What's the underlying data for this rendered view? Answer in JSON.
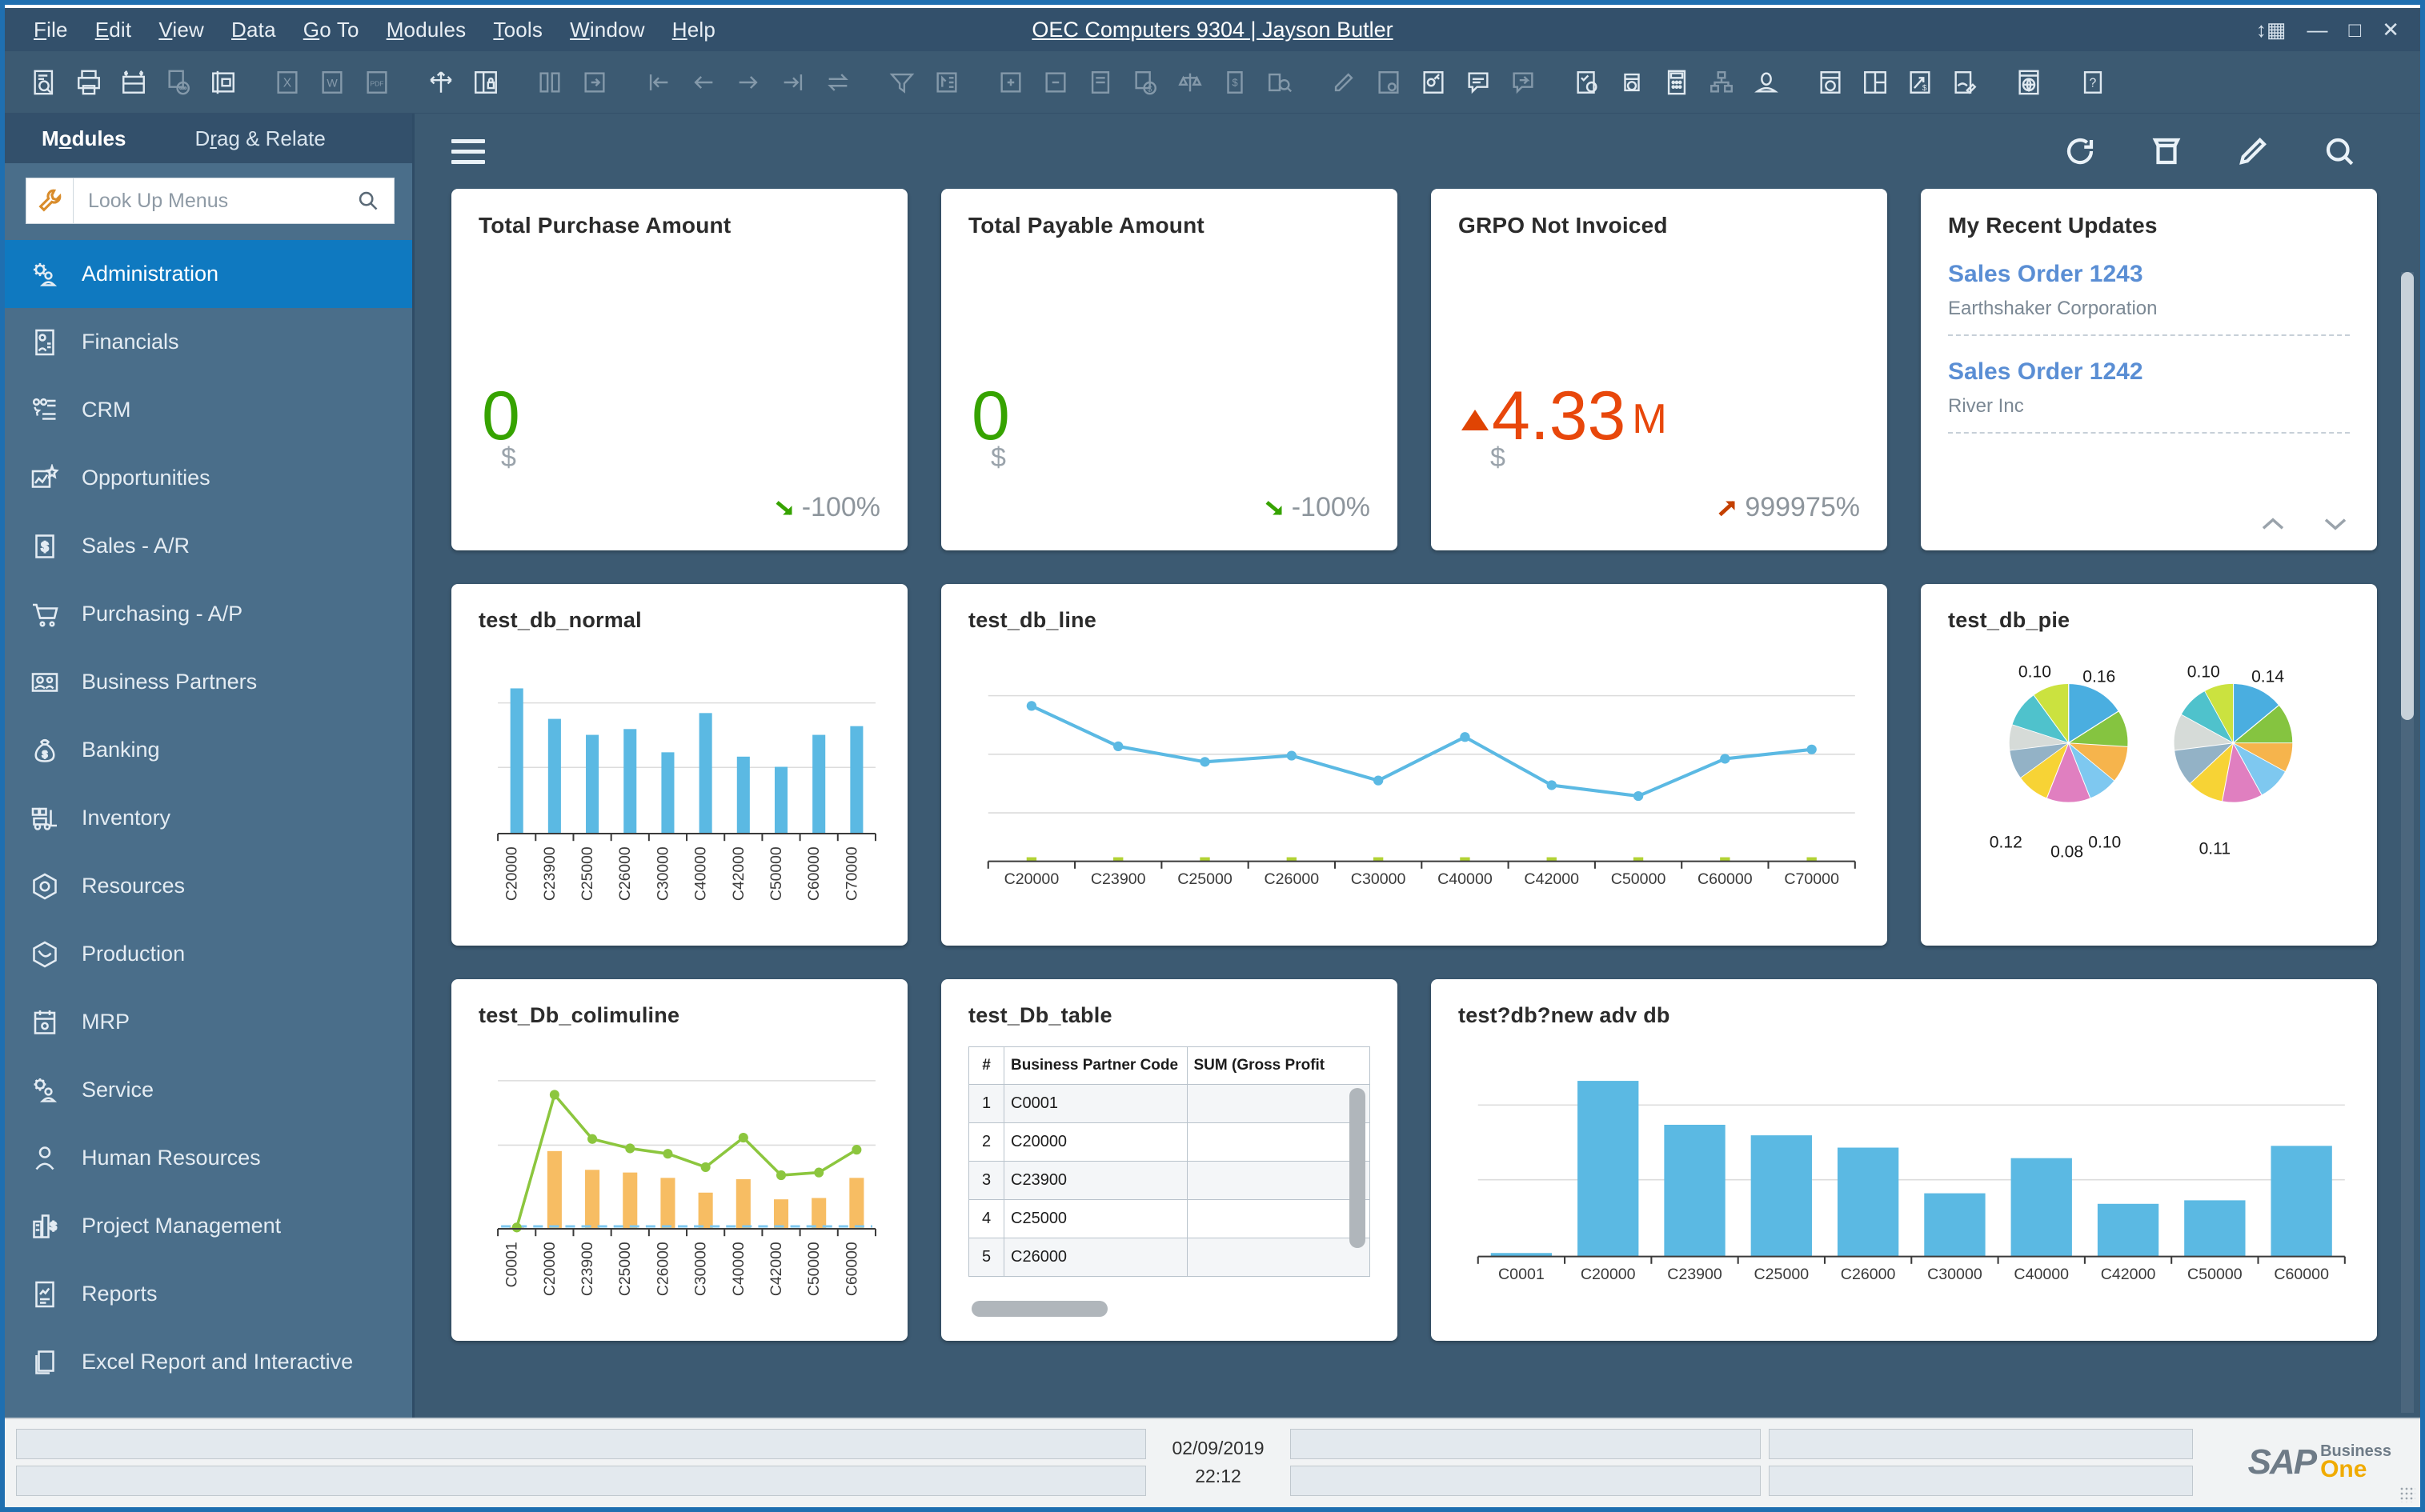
{
  "window": {
    "title": "OEC Computers 9304 | Jayson Butler",
    "controls": [
      "resize-icon",
      "minimize-icon",
      "maximize-icon",
      "close-icon"
    ]
  },
  "menubar": [
    {
      "label": "File",
      "mnemonic": "F"
    },
    {
      "label": "Edit",
      "mnemonic": "E"
    },
    {
      "label": "View",
      "mnemonic": "V"
    },
    {
      "label": "Data",
      "mnemonic": "D"
    },
    {
      "label": "Go To",
      "mnemonic": "G"
    },
    {
      "label": "Modules",
      "mnemonic": "M"
    },
    {
      "label": "Tools",
      "mnemonic": "T"
    },
    {
      "label": "Window",
      "mnemonic": "W"
    },
    {
      "label": "Help",
      "mnemonic": "H"
    }
  ],
  "toolbar": {
    "icons": [
      "find-document-icon",
      "print-icon",
      "print-preview-icon",
      "print-comment-icon",
      "layout-designer-icon",
      "export-excel-icon",
      "export-word-icon",
      "export-pdf-icon",
      "move-icon",
      "lock-screen-icon",
      "link-modules-icon",
      "goto-icon",
      "first-record-icon",
      "previous-record-icon",
      "next-record-icon",
      "last-record-icon",
      "swap-icon",
      "filter-icon",
      "sort-icon",
      "add-row-icon",
      "remove-row-icon",
      "document-journal-icon",
      "payment-icon",
      "balance-icon",
      "bank-icon",
      "query-icon",
      "edit-icon",
      "settings-doc-icon",
      "form-settings-icon",
      "message-icon",
      "reply-message-icon",
      "approval-icon",
      "alert-icon",
      "calculator-icon",
      "org-chart-icon",
      "user-icon",
      "document-globe-icon",
      "layout-tiles-icon",
      "trend-cost-icon",
      "signature-icon",
      "web-icon",
      "help-icon"
    ]
  },
  "sidebar": {
    "tabs": [
      {
        "label": "Modules",
        "mnemonic": "o",
        "active": true
      },
      {
        "label": "Drag & Relate",
        "mnemonic": "r",
        "active": false
      }
    ],
    "search": {
      "placeholder": "Look Up Menus",
      "value": "",
      "icon": "wrench-icon",
      "search_icon": "search-icon"
    },
    "items": [
      {
        "label": "Administration",
        "icon": "administration-icon",
        "active": true
      },
      {
        "label": "Financials",
        "icon": "financials-icon",
        "active": false
      },
      {
        "label": "CRM",
        "icon": "crm-icon",
        "active": false
      },
      {
        "label": "Opportunities",
        "icon": "opportunities-icon",
        "active": false
      },
      {
        "label": "Sales - A/R",
        "icon": "sales-icon",
        "active": false
      },
      {
        "label": "Purchasing - A/P",
        "icon": "cart-icon",
        "active": false
      },
      {
        "label": "Business Partners",
        "icon": "partners-icon",
        "active": false
      },
      {
        "label": "Banking",
        "icon": "money-bag-icon",
        "active": false
      },
      {
        "label": "Inventory",
        "icon": "forklift-icon",
        "active": false
      },
      {
        "label": "Resources",
        "icon": "resources-icon",
        "active": false
      },
      {
        "label": "Production",
        "icon": "production-icon",
        "active": false
      },
      {
        "label": "MRP",
        "icon": "calendar-icon",
        "active": false
      },
      {
        "label": "Service",
        "icon": "service-icon",
        "active": false
      },
      {
        "label": "Human Resources",
        "icon": "person-icon",
        "active": false
      },
      {
        "label": "Project Management",
        "icon": "project-icon",
        "active": false
      },
      {
        "label": "Reports",
        "icon": "report-icon",
        "active": false
      },
      {
        "label": "Excel Report and Interactive",
        "icon": "copy-icon",
        "active": false
      }
    ]
  },
  "dashboard": {
    "menu_icon": "hamburger-icon",
    "actions": [
      "refresh-icon",
      "archive-icon",
      "edit-pencil-icon",
      "search-icon"
    ],
    "kpis": [
      {
        "title": "Total Purchase Amount",
        "value": "0",
        "value_color": "#36a300",
        "currency": "$",
        "delta": "-100%",
        "trend": "down",
        "trend_color": "#36a300",
        "arrow": "arrow-down-right-icon"
      },
      {
        "title": "Total Payable Amount",
        "value": "0",
        "value_color": "#36a300",
        "currency": "$",
        "delta": "-100%",
        "trend": "down",
        "trend_color": "#36a300",
        "arrow": "arrow-down-right-icon"
      },
      {
        "title": "GRPO Not Invoiced",
        "value": "4.33",
        "suffix": "M",
        "value_color": "#e8470b",
        "currency": "$",
        "delta": "999975%",
        "trend": "up",
        "trend_color": "#c44000",
        "arrow": "arrow-up-right-icon",
        "marker": "triangle-up-icon"
      }
    ],
    "recent_updates": {
      "title": "My Recent Updates",
      "items": [
        {
          "link": "Sales Order 1243",
          "sub": "Earthshaker Corporation"
        },
        {
          "link": "Sales Order 1242",
          "sub": "River Inc"
        }
      ],
      "nav": [
        "chevron-up-icon",
        "chevron-down-icon"
      ]
    },
    "table_widget": {
      "title": "test_Db_table",
      "columns": [
        "#",
        "Business Partner Code",
        "SUM (Gross Profit"
      ],
      "rows": [
        [
          "1",
          "C0001",
          ""
        ],
        [
          "2",
          "C20000",
          ""
        ],
        [
          "3",
          "C23900",
          ""
        ],
        [
          "4",
          "C25000",
          ""
        ],
        [
          "5",
          "C26000",
          ""
        ]
      ]
    }
  },
  "chart_data": [
    {
      "type": "bar",
      "title": "test_db_normal",
      "categories": [
        "C20000",
        "C23900",
        "C25000",
        "C26000",
        "C30000",
        "C40000",
        "C42000",
        "C50000",
        "C60000",
        "C70000"
      ],
      "values": [
        100,
        79,
        68,
        72,
        56,
        83,
        53,
        46,
        68,
        74
      ],
      "ylim": [
        0,
        120
      ],
      "grid": true,
      "bar_color": "#5bb9e3",
      "xlabel": "",
      "ylabel": "",
      "tick_rotation": 90
    },
    {
      "type": "line",
      "title": "test_db_line",
      "categories": [
        "C20000",
        "C23900",
        "C25000",
        "C26000",
        "C30000",
        "C40000",
        "C42000",
        "C50000",
        "C60000",
        "C70000"
      ],
      "values": [
        100,
        74,
        64,
        68,
        52,
        80,
        49,
        42,
        66,
        72
      ],
      "ylim": [
        0,
        130
      ],
      "grid": true,
      "line_color": "#5bb9e3",
      "baseline_marker_color": "#b2d235",
      "xlabel": "",
      "ylabel": "",
      "tick_rotation": 0
    },
    {
      "type": "pie",
      "title": "test_db_pie",
      "charts": [
        {
          "labels_shown": [
            "0.10",
            "0.16",
            "0.10",
            "0.08",
            "0.12"
          ],
          "values": [
            0.16,
            0.1,
            0.1,
            0.08,
            0.12,
            0.09,
            0.08,
            0.07,
            0.1,
            0.1
          ],
          "colors": [
            "#4aaee0",
            "#85c440",
            "#f6b44c",
            "#7ec8f0",
            "#e07fc0",
            "#f7d335",
            "#93b2c6",
            "#d6dbd8",
            "#4fc2cc",
            "#cbe23f"
          ]
        },
        {
          "labels_shown": [
            "0.10",
            "0.14",
            "0.11"
          ],
          "values": [
            0.14,
            0.11,
            0.08,
            0.09,
            0.11,
            0.1,
            0.1,
            0.1,
            0.09,
            0.08
          ],
          "colors": [
            "#4aaee0",
            "#85c440",
            "#f6b44c",
            "#7ec8f0",
            "#e07fc0",
            "#f7d335",
            "#93b2c6",
            "#d6dbd8",
            "#4fc2cc",
            "#cbe23f"
          ]
        }
      ]
    },
    {
      "type": "bar",
      "title": "test_Db_colimuline",
      "categories": [
        "C0001",
        "C20000",
        "C23900",
        "C25000",
        "C26000",
        "C30000",
        "C40000",
        "C42000",
        "C50000",
        "C60000"
      ],
      "series": [
        {
          "name": "columns",
          "type": "bar",
          "color": "#f7bd63",
          "values": [
            1,
            58,
            44,
            42,
            38,
            27,
            37,
            22,
            23,
            38
          ]
        },
        {
          "name": "line",
          "type": "line",
          "color": "#8cc63e",
          "values": [
            1,
            100,
            67,
            60,
            56,
            46,
            68,
            40,
            42,
            59
          ]
        }
      ],
      "ylim": [
        0,
        130
      ],
      "grid": true,
      "tick_rotation": 90
    },
    {
      "type": "bar",
      "title": "test?db?new adv db",
      "categories": [
        "C0001",
        "C20000",
        "C23900",
        "C25000",
        "C26000",
        "C30000",
        "C40000",
        "C42000",
        "C50000",
        "C60000"
      ],
      "values": [
        2,
        100,
        75,
        69,
        62,
        36,
        56,
        30,
        32,
        63
      ],
      "ylim": [
        0,
        115
      ],
      "grid": true,
      "bar_color": "#5bb9e3",
      "tick_rotation": 0
    }
  ],
  "statusbar": {
    "date": "02/09/2019",
    "time": "22:12",
    "logo": {
      "brand": "SAP",
      "line1": "Business",
      "line2": "One"
    }
  }
}
